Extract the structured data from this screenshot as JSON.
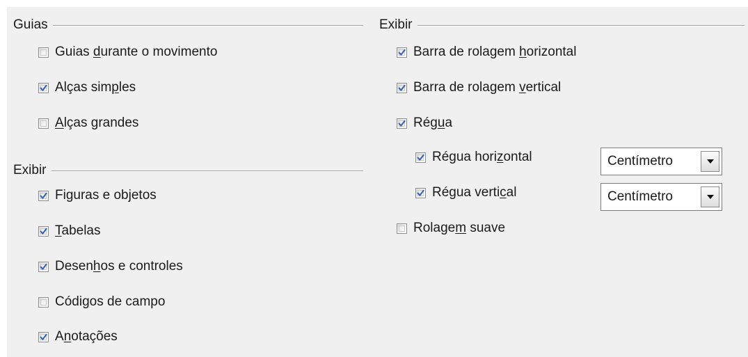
{
  "guides": {
    "title": "Guias",
    "options": [
      {
        "pre": "Guias ",
        "key": "d",
        "post": "urante o movimento",
        "checked": false
      },
      {
        "pre": "Alças sim",
        "key": "p",
        "post": "les",
        "checked": true
      },
      {
        "pre": "",
        "key": "A",
        "post": "lças grandes",
        "checked": false
      }
    ]
  },
  "display_left": {
    "title": "Exibir",
    "options": [
      {
        "pre": "Fi",
        "key": "g",
        "post": "uras e objetos",
        "checked": true
      },
      {
        "pre": "",
        "key": "T",
        "post": "abelas",
        "checked": true
      },
      {
        "pre": "Desen",
        "key": "h",
        "post": "os e controles",
        "checked": true
      },
      {
        "pre": "Códi",
        "key": "g",
        "post": "os de campo",
        "checked": false
      },
      {
        "pre": "A",
        "key": "n",
        "post": "otações",
        "checked": true
      }
    ]
  },
  "display_right": {
    "title": "Exibir",
    "options": [
      {
        "pre": "Barra de rolagem ",
        "key": "h",
        "post": "orizontal",
        "checked": true
      },
      {
        "pre": "Barra de rolagem ",
        "key": "v",
        "post": "ertical",
        "checked": true
      },
      {
        "pre": "Rég",
        "key": "u",
        "post": "a",
        "checked": true
      },
      {
        "pre": "Régua hori",
        "key": "z",
        "post": "ontal",
        "checked": true
      },
      {
        "pre": "Régua verti",
        "key": "c",
        "post": "al",
        "checked": true
      },
      {
        "pre": "Rolage",
        "key": "m",
        "post": " suave",
        "checked": false
      }
    ],
    "unit_horizontal": "Centímetro",
    "unit_vertical": "Centímetro"
  },
  "colors": {
    "check": "#3c62b8",
    "panel": "#f0f0f0"
  }
}
